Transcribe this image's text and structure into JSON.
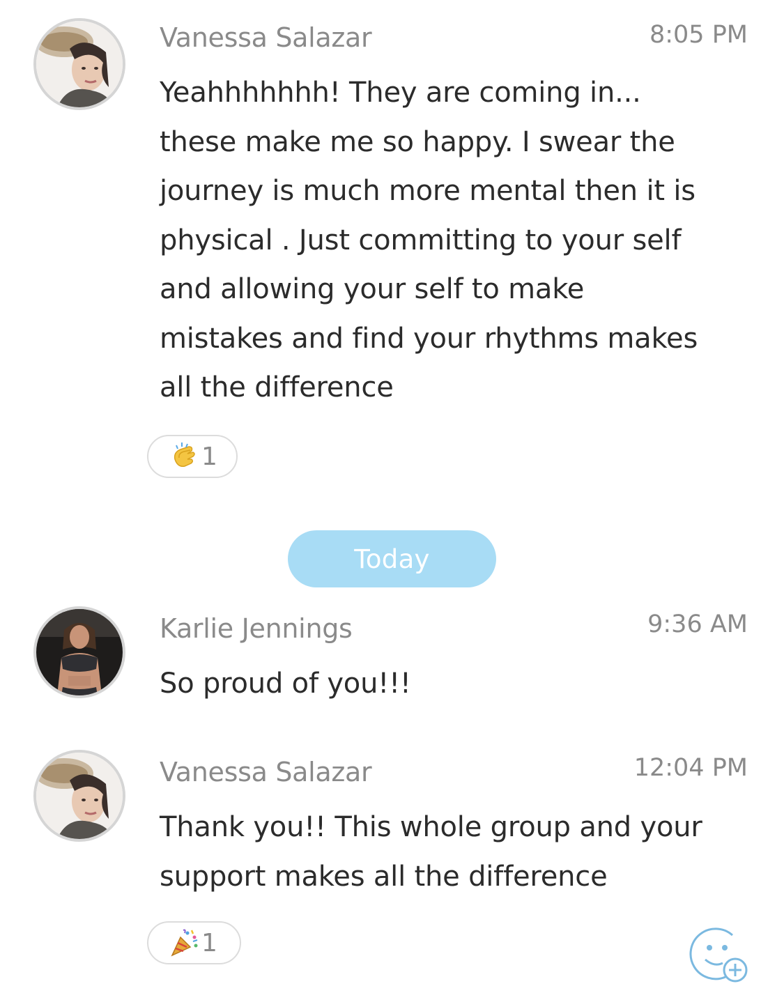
{
  "messages": [
    {
      "sender": "Vanessa Salazar",
      "time": "8:05 PM",
      "text": "Yeahhhhhhh! They are coming in...\nthese make me so happy. I swear the\njourney is much more mental then it is\nphysical . Just committing to your self\nand allowing your self to make\nmistakes and find your rhythms makes\nall the difference",
      "avatar_icon": "avatar-photo-woman-hat",
      "reaction": {
        "emoji_icon": "clapping-hands-icon",
        "count": "1"
      }
    },
    {
      "sender": "Karlie Jennings",
      "time": "9:36 AM",
      "text": "So proud of you!!!",
      "avatar_icon": "avatar-photo-fitness-woman"
    },
    {
      "sender": "Vanessa Salazar",
      "time": "12:04 PM",
      "text": "Thank you!!  This whole group and your\nsupport makes all the difference",
      "avatar_icon": "avatar-photo-woman-hat",
      "reaction": {
        "emoji_icon": "party-popper-icon",
        "count": "1"
      }
    }
  ],
  "divider": {
    "label": "Today",
    "color": "#a8dcf5"
  },
  "add_reaction": {
    "icon": "add-emoji-reaction-icon",
    "color": "#7bb9e0"
  }
}
